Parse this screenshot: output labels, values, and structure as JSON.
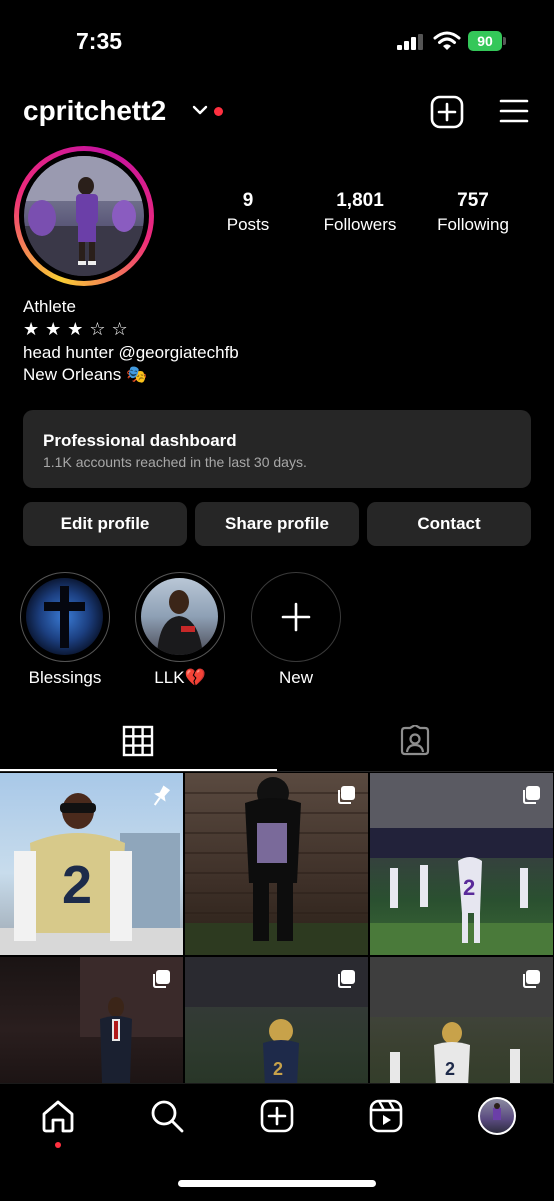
{
  "status_bar": {
    "time": "7:35",
    "battery": "90"
  },
  "header": {
    "username": "cpritchett2"
  },
  "stats": [
    {
      "value": "9",
      "label": "Posts"
    },
    {
      "value": "1,801",
      "label": "Followers"
    },
    {
      "value": "757",
      "label": "Following"
    }
  ],
  "bio": {
    "category": "Athlete",
    "stars": "★ ★ ★ ☆ ☆",
    "line1": "head hunter @georgiatechfb",
    "location": "New Orleans 🎭"
  },
  "dashboard": {
    "title": "Professional dashboard",
    "subtitle": "1.1K accounts reached in the last 30 days."
  },
  "buttons": {
    "edit": "Edit profile",
    "share": "Share profile",
    "contact": "Contact"
  },
  "highlights": [
    {
      "label": "Blessings"
    },
    {
      "label": "LLK💔"
    },
    {
      "label": "New"
    }
  ],
  "colors": {
    "accent_red": "#ff3040",
    "battery_green": "#34c759",
    "surface": "#262626"
  },
  "icons": [
    "grid-icon",
    "tagged-icon",
    "home-icon",
    "search-icon",
    "create-icon",
    "reels-icon",
    "pin-icon",
    "multi-photo-icon"
  ]
}
